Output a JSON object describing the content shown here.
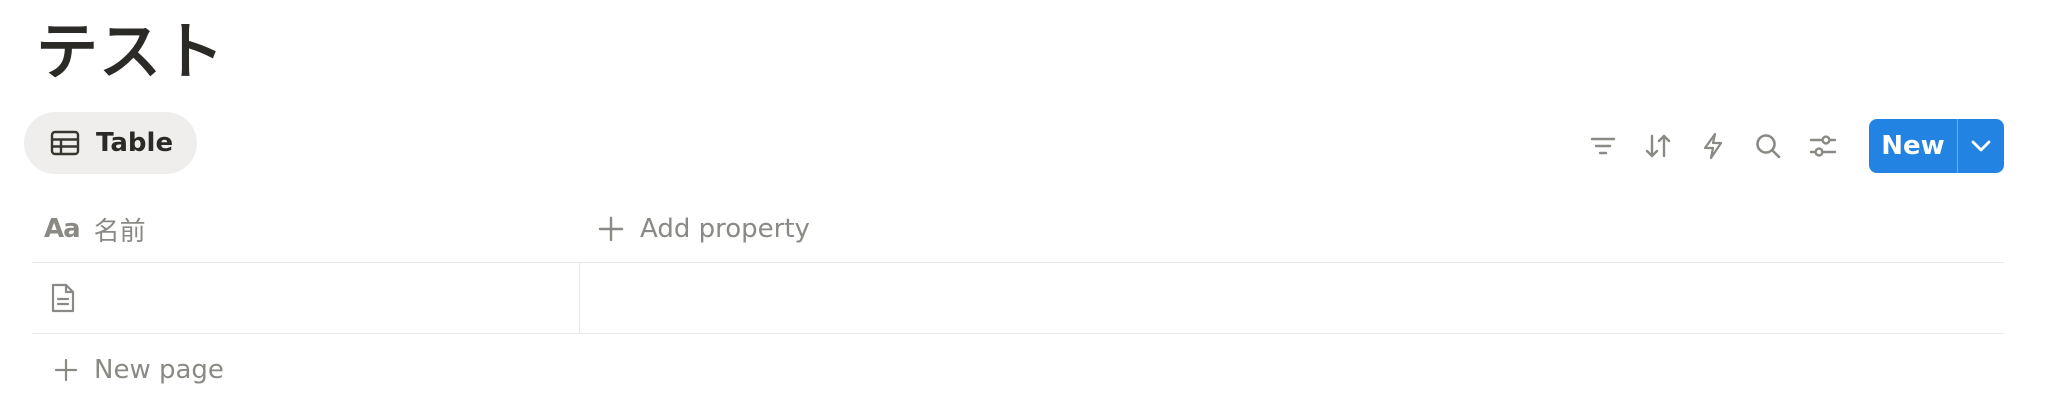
{
  "page": {
    "title": "テスト"
  },
  "view_tab": {
    "label": "Table",
    "icon": "table-icon"
  },
  "toolbar": {
    "icons": [
      "filter-icon",
      "sort-icon",
      "automation-bolt-icon",
      "search-icon",
      "settings-sliders-icon"
    ],
    "new_label": "New",
    "new_dropdown_icon": "chevron-down-icon",
    "accent_color": "#2383e2"
  },
  "table": {
    "columns": [
      {
        "type_label": "Aa",
        "label": "名前",
        "icon": "title-property-icon"
      }
    ],
    "add_property_label": "Add property",
    "rows": [
      {
        "name": "",
        "icon": "page-icon"
      }
    ],
    "new_page_label": "New page"
  }
}
